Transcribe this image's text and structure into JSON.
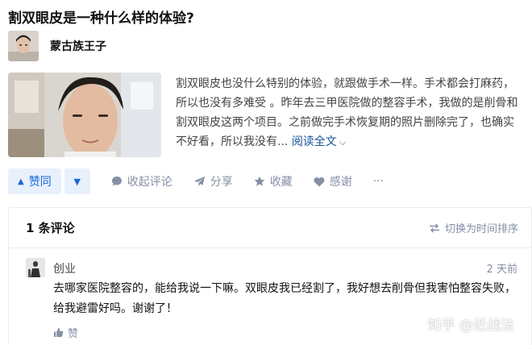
{
  "question": {
    "title": "割双眼皮是一种什么样的体验?"
  },
  "author": {
    "name": "蒙古族王子"
  },
  "answer": {
    "excerpt": "割双眼皮也没什么特别的体验，就跟做手术一样。手术都会打麻药，所以也没有多难受 。昨年去三甲医院做的整容手术，我做的是削骨和割双眼皮这两个项目。之前做完手术恢复期的照片删除完了，也确实不好看，所以我没有...",
    "read_more": "阅读全文"
  },
  "actions": {
    "upvote": "赞同",
    "collapse_comments": "收起评论",
    "share": "分享",
    "favorite": "收藏",
    "thanks": "感谢",
    "more": "···"
  },
  "comments": {
    "count_label": "1 条评论",
    "sort_toggle": "切换为时间排序",
    "items": [
      {
        "user": "创业",
        "time": "2 天前",
        "text": "去哪家医院整容的，能给我说一下嘛。双眼皮我已经割了，我好想去削骨但我害怕整容失败，给我避雷好吗。谢谢了！",
        "like": "赞"
      }
    ]
  },
  "watermark": "知乎 @近战法",
  "colors": {
    "accent": "#1766d6",
    "accent_bg": "#e8f0fb",
    "muted": "#8590a6",
    "link": "#175199"
  }
}
